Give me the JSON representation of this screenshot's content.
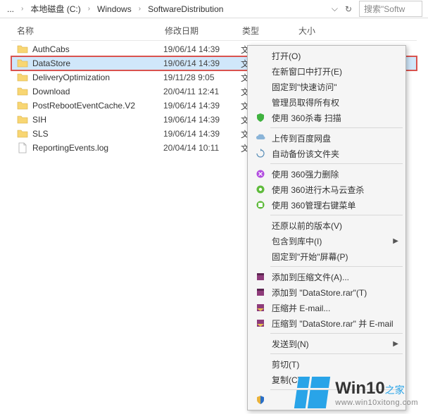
{
  "address": {
    "crumbs": [
      "...",
      "本地磁盘 (C:)",
      "Windows",
      "SoftwareDistribution"
    ],
    "search_placeholder": "搜索\"Softw"
  },
  "columns": {
    "name": "名称",
    "date": "修改日期",
    "type": "类型",
    "size": "大小"
  },
  "rows": [
    {
      "name": "AuthCabs",
      "date": "19/06/14 14:39",
      "type": "文件夹",
      "icon": "folder"
    },
    {
      "name": "DataStore",
      "date": "19/06/14 14:39",
      "type": "文件夹",
      "icon": "folder",
      "selected": true
    },
    {
      "name": "DeliveryOptimization",
      "date": "19/11/28 9:05",
      "type": "文",
      "icon": "folder"
    },
    {
      "name": "Download",
      "date": "20/04/11 12:41",
      "type": "文",
      "icon": "folder"
    },
    {
      "name": "PostRebootEventCache.V2",
      "date": "19/06/14 14:39",
      "type": "文",
      "icon": "folder"
    },
    {
      "name": "SIH",
      "date": "19/06/14 14:39",
      "type": "文",
      "icon": "folder"
    },
    {
      "name": "SLS",
      "date": "19/06/14 14:39",
      "type": "文",
      "icon": "folder"
    },
    {
      "name": "ReportingEvents.log",
      "date": "20/04/14 10:11",
      "type": "文",
      "icon": "file"
    }
  ],
  "menu": {
    "open": "打开(O)",
    "open_new": "在新窗口中打开(E)",
    "pin_quick": "固定到\"快速访问\"",
    "admin": "管理员取得所有权",
    "scan360": "使用 360杀毒 扫描",
    "baidu": "上传到百度网盘",
    "autobak": "自动备份该文件夹",
    "forcedel": "使用 360强力删除",
    "trojan": "使用 360进行木马云查杀",
    "rclickmgr": "使用 360管理右键菜单",
    "restore": "还原以前的版本(V)",
    "library": "包含到库中(I)",
    "pin_start": "固定到\"开始\"屏幕(P)",
    "addarc": "添加到压缩文件(A)...",
    "addrar": "添加到 \"DataStore.rar\"(T)",
    "email": "压缩并 E-mail...",
    "emailrar": "压缩到 \"DataStore.rar\" 并 E-mail",
    "sendto": "发送到(N)",
    "cut": "剪切(T)",
    "copy": "复制(C)"
  },
  "watermark": {
    "t1": "Win10",
    "t2": "之家",
    "url": "www.win10xitong.com"
  }
}
